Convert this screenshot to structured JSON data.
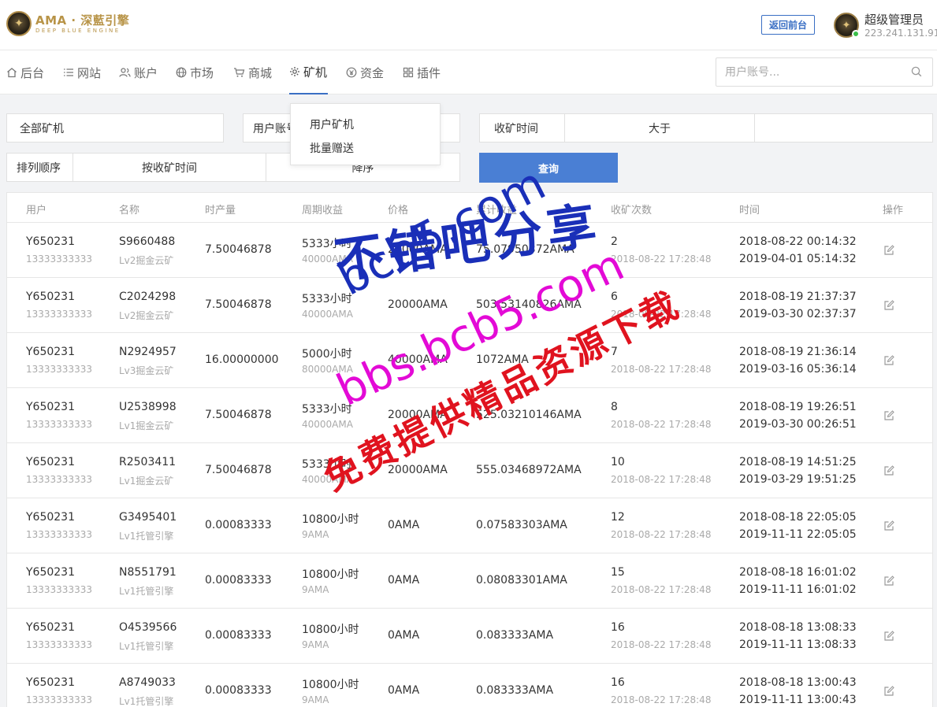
{
  "header": {
    "logo_main": "AMA · 深藍引擎",
    "logo_sub": "DEEP BLUE ENGINE",
    "back_button": "返回前台",
    "user_name": "超级管理员",
    "user_ip": "223.241.131.91"
  },
  "nav": {
    "items": [
      {
        "label": "后台",
        "icon": "home-icon"
      },
      {
        "label": "网站",
        "icon": "list-icon"
      },
      {
        "label": "账户",
        "icon": "users-icon"
      },
      {
        "label": "市场",
        "icon": "globe-icon"
      },
      {
        "label": "商城",
        "icon": "cart-icon"
      },
      {
        "label": "矿机",
        "icon": "gear-icon"
      },
      {
        "label": "资金",
        "icon": "coin-icon"
      },
      {
        "label": "插件",
        "icon": "grid-icon"
      }
    ],
    "active": "矿机",
    "search_placeholder": "用户账号..."
  },
  "dropdown": {
    "items": [
      "用户矿机",
      "批量赠送"
    ]
  },
  "filters": {
    "miner_select": "全部矿机",
    "user_account_label": "用户账号",
    "harvest_time_label": "收矿时间",
    "compare_select": "大于",
    "harvest_time_value": "",
    "sort_label": "排列顺序",
    "sort_field": "按收矿时间",
    "sort_order": "降序",
    "query_button": "查询"
  },
  "table": {
    "columns": [
      "用户",
      "名称",
      "时产量",
      "周期收益",
      "价格",
      "累计收益",
      "收矿次数",
      "时间",
      "操作"
    ],
    "rows": [
      {
        "user": "Y650231",
        "phone": "13333333333",
        "code": "S9660488",
        "level": "Lv2掘金云矿",
        "rate": "7.50046878",
        "cycle": "5333小时",
        "cycle_sub": "40000AMA",
        "price": "20000AMA",
        "total": "75.07950372AMA",
        "count": "2",
        "count_time": "2018-08-22 17:28:48",
        "time1": "2018-08-22 00:14:32",
        "time2": "2019-04-01 05:14:32"
      },
      {
        "user": "Y650231",
        "phone": "13333333333",
        "code": "C2024298",
        "level": "Lv2掘金云矿",
        "rate": "7.50046878",
        "cycle": "5333小时",
        "cycle_sub": "40000AMA",
        "price": "20000AMA",
        "total": "503.53140826AMA",
        "count": "6",
        "count_time": "2018-08-22 17:28:48",
        "time1": "2018-08-19 21:37:37",
        "time2": "2019-03-30 02:37:37"
      },
      {
        "user": "Y650231",
        "phone": "13333333333",
        "code": "N2924957",
        "level": "Lv3掘金云矿",
        "rate": "16.00000000",
        "cycle": "5000小时",
        "cycle_sub": "80000AMA",
        "price": "40000AMA",
        "total": "1072AMA",
        "count": "7",
        "count_time": "2018-08-22 17:28:48",
        "time1": "2018-08-19 21:36:14",
        "time2": "2019-03-16 05:36:14"
      },
      {
        "user": "Y650231",
        "phone": "13333333333",
        "code": "U2538998",
        "level": "Lv1掘金云矿",
        "rate": "7.50046878",
        "cycle": "5333小时",
        "cycle_sub": "40000AMA",
        "price": "20000AMA",
        "total": "525.03210146AMA",
        "count": "8",
        "count_time": "2018-08-22 17:28:48",
        "time1": "2018-08-19 19:26:51",
        "time2": "2019-03-30 00:26:51"
      },
      {
        "user": "Y650231",
        "phone": "13333333333",
        "code": "R2503411",
        "level": "Lv1掘金云矿",
        "rate": "7.50046878",
        "cycle": "5333小时",
        "cycle_sub": "40000AMA",
        "price": "20000AMA",
        "total": "555.03468972AMA",
        "count": "10",
        "count_time": "2018-08-22 17:28:48",
        "time1": "2018-08-19 14:51:25",
        "time2": "2019-03-29 19:51:25"
      },
      {
        "user": "Y650231",
        "phone": "13333333333",
        "code": "G3495401",
        "level": "Lv1托管引擎",
        "rate": "0.00083333",
        "cycle": "10800小时",
        "cycle_sub": "9AMA",
        "price": "0AMA",
        "total": "0.07583303AMA",
        "count": "12",
        "count_time": "2018-08-22 17:28:48",
        "time1": "2018-08-18 22:05:05",
        "time2": "2019-11-11 22:05:05"
      },
      {
        "user": "Y650231",
        "phone": "13333333333",
        "code": "N8551791",
        "level": "Lv1托管引擎",
        "rate": "0.00083333",
        "cycle": "10800小时",
        "cycle_sub": "9AMA",
        "price": "0AMA",
        "total": "0.08083301AMA",
        "count": "15",
        "count_time": "2018-08-22 17:28:48",
        "time1": "2018-08-18 16:01:02",
        "time2": "2019-11-11 16:01:02"
      },
      {
        "user": "Y650231",
        "phone": "13333333333",
        "code": "O4539566",
        "level": "Lv1托管引擎",
        "rate": "0.00083333",
        "cycle": "10800小时",
        "cycle_sub": "9AMA",
        "price": "0AMA",
        "total": "0.083333AMA",
        "count": "16",
        "count_time": "2018-08-22 17:28:48",
        "time1": "2018-08-18 13:08:33",
        "time2": "2019-11-11 13:08:33"
      },
      {
        "user": "Y650231",
        "phone": "13333333333",
        "code": "A8749033",
        "level": "Lv1托管引擎",
        "rate": "0.00083333",
        "cycle": "10800小时",
        "cycle_sub": "9AMA",
        "price": "0AMA",
        "total": "0.083333AMA",
        "count": "16",
        "count_time": "2018-08-22 17:28:48",
        "time1": "2018-08-18 13:00:43",
        "time2": "2019-11-11 13:00:43"
      }
    ]
  },
  "watermark": {
    "line1": "不错吧分享",
    "line2": "bcb5.com",
    "line3": "bbs.bcb5.com",
    "line4": "免费提供精品资源下载"
  }
}
